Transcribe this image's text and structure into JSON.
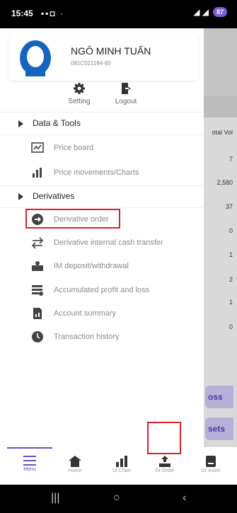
{
  "status_bar": {
    "time": "15:45",
    "battery": "87"
  },
  "drawer": {
    "user": {
      "name": "NGÔ MINH TUẤN",
      "id": "081C021184-80"
    },
    "quick_actions": [
      {
        "label": "Setting",
        "icon": "gear-icon"
      },
      {
        "label": "Logout",
        "icon": "logout-icon"
      }
    ],
    "sections": [
      {
        "title": "Data & Tools",
        "items": [
          {
            "label": "Price board",
            "icon": "price-board-icon"
          },
          {
            "label": "Price movements/Charts",
            "icon": "bar-chart-icon"
          }
        ]
      },
      {
        "title": "Derivatives",
        "items": [
          {
            "label": "Derivative order",
            "icon": "arrow-circle-icon"
          },
          {
            "label": "Derivative internal cash transfer",
            "icon": "transfer-icon"
          },
          {
            "label": "IM deposit/withdrawal",
            "icon": "deposit-icon"
          },
          {
            "label": "Accumulated profit and loss",
            "icon": "profit-loss-icon"
          },
          {
            "label": "Account summary",
            "icon": "account-summary-icon"
          },
          {
            "label": "Transaction history",
            "icon": "clock-icon"
          }
        ]
      }
    ]
  },
  "background": {
    "column_header": "otal Vol",
    "values": [
      "7",
      "2,580",
      "37",
      "0",
      "1",
      "2",
      "1",
      "0"
    ],
    "buttons": [
      "oss",
      "sets"
    ]
  },
  "bottom_nav": [
    {
      "label": "Menu",
      "icon": "menu-icon",
      "active": true
    },
    {
      "label": "Home",
      "icon": "home-icon"
    },
    {
      "label": "Dr.Chart",
      "icon": "chart-icon"
    },
    {
      "label": "Dr.Order",
      "icon": "order-icon"
    },
    {
      "label": "Dr.Asset",
      "icon": "asset-icon"
    }
  ],
  "colors": {
    "accent": "#6a4fc7",
    "highlight": "#e01e2b",
    "avatar": "#1565c0"
  }
}
